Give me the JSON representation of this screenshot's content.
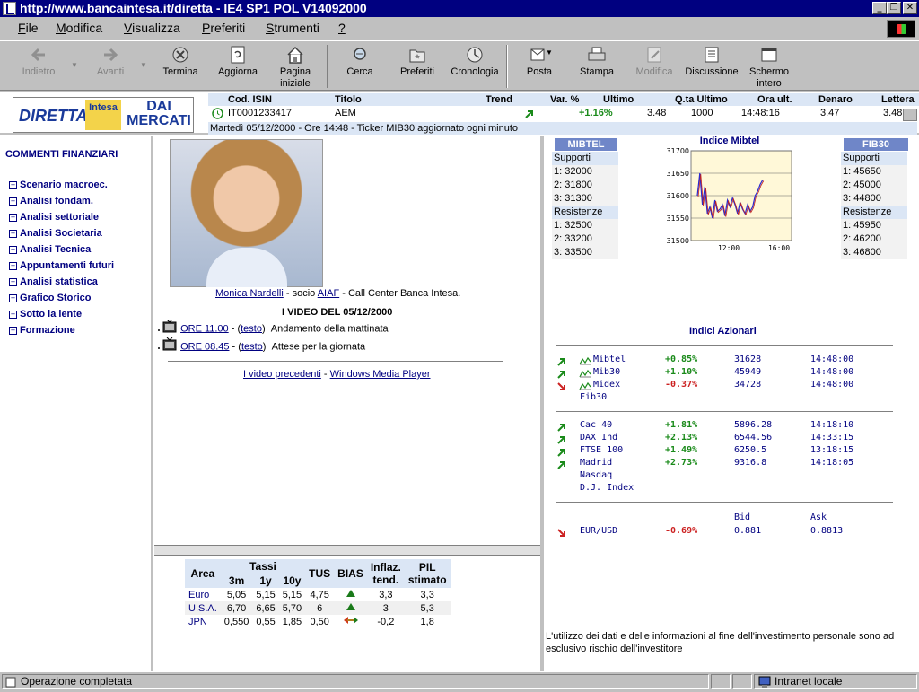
{
  "window": {
    "title": "http://www.bancaintesa.it/diretta - IE4 SP1 POL V14092000"
  },
  "menu": [
    {
      "u": "F",
      "rest": "ile"
    },
    {
      "u": "M",
      "rest": "odifica"
    },
    {
      "u": "V",
      "rest": "isualizza"
    },
    {
      "u": "P",
      "rest": "referiti"
    },
    {
      "u": "S",
      "rest": "trumenti"
    },
    {
      "u": "?",
      "rest": ""
    }
  ],
  "toolbar": {
    "back": "Indietro",
    "forward": "Avanti",
    "stop": "Termina",
    "refresh": "Aggiorna",
    "home1": "Pagina",
    "home2": "iniziale",
    "search": "Cerca",
    "favorites": "Preferiti",
    "history": "Cronologia",
    "mail": "Posta",
    "print": "Stampa",
    "edit": "Modifica",
    "discuss": "Discussione",
    "fullscreen1": "Schermo",
    "fullscreen2": "intero"
  },
  "logo": {
    "diretta": "DIRETTA",
    "intesa": "Intesa",
    "dai": "DAI",
    "mercati": "MERCATI"
  },
  "ticker": {
    "headers": [
      "Cod. ISIN",
      "Titolo",
      "Trend",
      "Var. %",
      "Ultimo",
      "Q.ta Ultimo",
      "Ora ult.",
      "Denaro",
      "Lettera"
    ],
    "row": {
      "isin": "IT0001233417",
      "titolo": "AEM",
      "var": "+1.16%",
      "ultimo": "3.48",
      "qta": "1000",
      "ora": "14:48:16",
      "denaro": "3.47",
      "lettera": "3.48"
    },
    "message": "Martedì 05/12/2000 - Ore 14:48 - Ticker MIB30 aggiornato ogni minuto"
  },
  "nav": {
    "heading": "COMMENTI FINANZIARI",
    "items": [
      "Scenario macroec.",
      "Analisi fondam.",
      "Analisi settoriale",
      "Analisi Societaria",
      "Analisi Tecnica",
      "Appuntamenti futuri",
      "Analisi statistica",
      "Grafico Storico",
      "Sotto la lente",
      "Formazione"
    ]
  },
  "center": {
    "person_name": "Monica Nardelli",
    "person_mid": " - socio ",
    "person_org": "AIAF",
    "person_end": " - Call Center Banca Intesa.",
    "video_title": "I VIDEO DEL 05/12/2000",
    "videos": [
      {
        "time": "ORE 11.00",
        "sep1": " - (",
        "text": "testo",
        "sep2": ")",
        "desc": "Andamento della mattinata"
      },
      {
        "time": "ORE 08.45",
        "sep1": " - (",
        "text": "testo",
        "sep2": ")",
        "desc": "Attese per la giornata"
      }
    ],
    "prev_videos": "I video precedenti",
    "sep": " - ",
    "player": "Windows Media Player"
  },
  "rates": {
    "h_area": "Area",
    "h_tassi": "Tassi",
    "h_3m": "3m",
    "h_1y": "1y",
    "h_10y": "10y",
    "h_tus": "TUS",
    "h_bias": "BIAS",
    "h_infl1": "Inflaz.",
    "h_infl2": "tend.",
    "h_pil1": "PIL",
    "h_pil2": "stimato",
    "rows": [
      {
        "area": "Euro",
        "m3": "5,05",
        "y1": "5,15",
        "y10": "5,15",
        "tus": "4,75",
        "bias": "up",
        "infl": "3,3",
        "pil": "3,3"
      },
      {
        "area": "U.S.A.",
        "m3": "6,70",
        "y1": "6,65",
        "y10": "5,70",
        "tus": "6",
        "bias": "up",
        "infl": "3",
        "pil": "5,3"
      },
      {
        "area": "JPN",
        "m3": "0,550",
        "y1": "0,55",
        "y10": "1,85",
        "tus": "0,50",
        "bias": "flat",
        "infl": "-0,2",
        "pil": "1,8"
      }
    ]
  },
  "mibtel": {
    "head": "MIBTEL",
    "supporti": "Supporti",
    "resistenze": "Resistenze",
    "s": [
      "1: 32000",
      "2: 31800",
      "3: 31300"
    ],
    "r": [
      "1: 32500",
      "2: 33200",
      "3: 33500"
    ]
  },
  "fib30": {
    "head": "FIB30",
    "supporti": "Supporti",
    "resistenze": "Resistenze",
    "s": [
      "1: 45650",
      "2: 45000",
      "3: 44800"
    ],
    "r": [
      "1: 45950",
      "2: 46200",
      "3: 46800"
    ]
  },
  "chart_data": {
    "type": "line",
    "title": "Indice Mibtel",
    "yticks": [
      "31700",
      "31650",
      "31600",
      "31550",
      "31500"
    ],
    "xticks": [
      "12:00",
      "16:00"
    ],
    "ylim": [
      31500,
      31700
    ],
    "x": [
      9.5,
      9.7,
      9.9,
      10.1,
      10.3,
      10.5,
      10.7,
      10.9,
      11.1,
      11.3,
      11.5,
      11.7,
      11.9,
      12.1,
      12.3,
      12.5,
      12.7,
      12.9,
      13.1,
      13.3,
      13.5,
      13.7,
      13.9,
      14.1,
      14.3,
      14.5,
      14.7
    ],
    "y": [
      31600,
      31650,
      31580,
      31620,
      31560,
      31575,
      31550,
      31590,
      31565,
      31570,
      31580,
      31555,
      31590,
      31575,
      31595,
      31580,
      31560,
      31585,
      31570,
      31560,
      31580,
      31565,
      31575,
      31600,
      31610,
      31625,
      31635
    ],
    "xrange": [
      9,
      17
    ]
  },
  "indici": {
    "title": "Indici Azionari",
    "group1": [
      {
        "trend": "up",
        "chart": true,
        "name": "Mibtel",
        "var": "+0.85%",
        "val": "31628",
        "time": "14:48:00"
      },
      {
        "trend": "up",
        "chart": true,
        "name": "Mib30",
        "var": "+1.10%",
        "val": "45949",
        "time": "14:48:00"
      },
      {
        "trend": "down",
        "chart": true,
        "name": "Midex",
        "var": "-0.37%",
        "val": "34728",
        "time": "14:48:00"
      },
      {
        "trend": "",
        "chart": false,
        "name": "Fib30",
        "var": "",
        "val": "",
        "time": ""
      }
    ],
    "group2": [
      {
        "trend": "up",
        "name": "Cac 40",
        "var": "+1.81%",
        "val": "5896.28",
        "time": "14:18:10"
      },
      {
        "trend": "up",
        "name": "DAX Ind",
        "var": "+2.13%",
        "val": "6544.56",
        "time": "14:33:15"
      },
      {
        "trend": "up",
        "name": "FTSE 100",
        "var": "+1.49%",
        "val": "6250.5",
        "time": "13:18:15"
      },
      {
        "trend": "up",
        "name": "Madrid",
        "var": "+2.73%",
        "val": "9316.8",
        "time": "14:18:05"
      },
      {
        "trend": "",
        "name": "Nasdaq",
        "var": "",
        "val": "",
        "time": ""
      },
      {
        "trend": "",
        "name": "D.J. Index",
        "var": "",
        "val": "",
        "time": ""
      }
    ],
    "fx_bid": "Bid",
    "fx_ask": "Ask",
    "fx": {
      "trend": "down",
      "name": "EUR/USD",
      "var": "-0.69%",
      "bid": "0.881",
      "ask": "0.8813"
    }
  },
  "disclaimer": "L'utilizzo dei dati e delle informazioni al fine dell'investimento personale sono ad esclusivo rischio dell'investitore",
  "status": {
    "text": "Operazione completata",
    "zone": "Intranet locale"
  }
}
